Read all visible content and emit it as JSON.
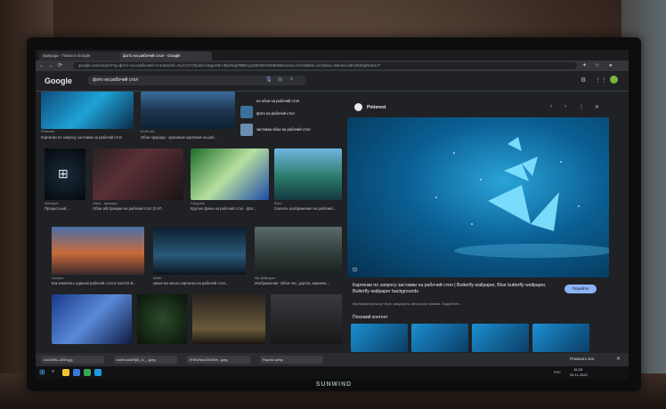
{
  "browser": {
    "tabs": [
      {
        "label": "природа - Поиск в Google"
      },
      {
        "label": "фото на рабочий стол - Google"
      }
    ],
    "url": "google.com/search?q=фото+на+рабочий+стол&sxsrf=ALiCzsYZrjobw-bSgoKB-cBpVbqO9BEcg1669481945668&source=lnms&tbm=isch&sa=X&ved=2ahUKEwjNutreo7"
  },
  "google": {
    "logo": "Google",
    "query": "фото на рабочий стол"
  },
  "results": {
    "top_left_caption": "Картинки по запросу заставки на рабочий стол",
    "top_left_source": "Pinterest",
    "top_mid_caption": "Обои природа - красивые картинки на раб...",
    "top_mid_source": "KLife.net",
    "side": [
      {
        "label": "на обои на рабочий стол"
      },
      {
        "label": "фото на рабочий стол"
      },
      {
        "label": "заставка обои на рабочий стол"
      }
    ],
    "row2": [
      {
        "caption": "Процессный ...",
        "source": "Windows"
      },
      {
        "caption": "Обои абстракция на рабочий стол (2 97...",
        "source": "Обои - Авиатры"
      },
      {
        "caption": "Крутые фоны на рабочий стол - фот...",
        "source": "Fdng.info"
      },
      {
        "caption": "Скачать изображения на рабочий...",
        "source": "Фото"
      }
    ],
    "row3": [
      {
        "caption": "Как изменить единый рабочий стол в macOS B...",
        "source": "Gooden"
      },
      {
        "caption": "какая же много картинка на рабочий стол...",
        "source": "Imker"
      },
      {
        "caption": "Изображение: Обои лес, дорога, машина...",
        "source": "My Wallpaper"
      }
    ]
  },
  "panel": {
    "source": "Pinterest",
    "title": "Картинки по запросу заставки на рабочий стол | Butterfly wallpaper, Blue butterfly wallpaper, Butterfly wallpaper backgrounds",
    "note": "Изображения могут быть защищены авторским правом. Подробнее...",
    "button": "Перейти",
    "related": "Похожий контент",
    "tooltip": "На рабочем"
  },
  "downloads": [
    {
      "label": "ссl1489с-1850.jpg"
    },
    {
      "label": "bdetf-wdDRjt2_D_...jpeg"
    },
    {
      "label": "IFWUNeyOH3K0t...jpeg"
    },
    {
      "label": "Ripxml.webp"
    }
  ],
  "downloads_show_all": "Показать все",
  "taskbar": {
    "lang": "РУС",
    "time": "16:28",
    "date": "26.11.2022"
  },
  "monitor_brand": "SUNWIND"
}
